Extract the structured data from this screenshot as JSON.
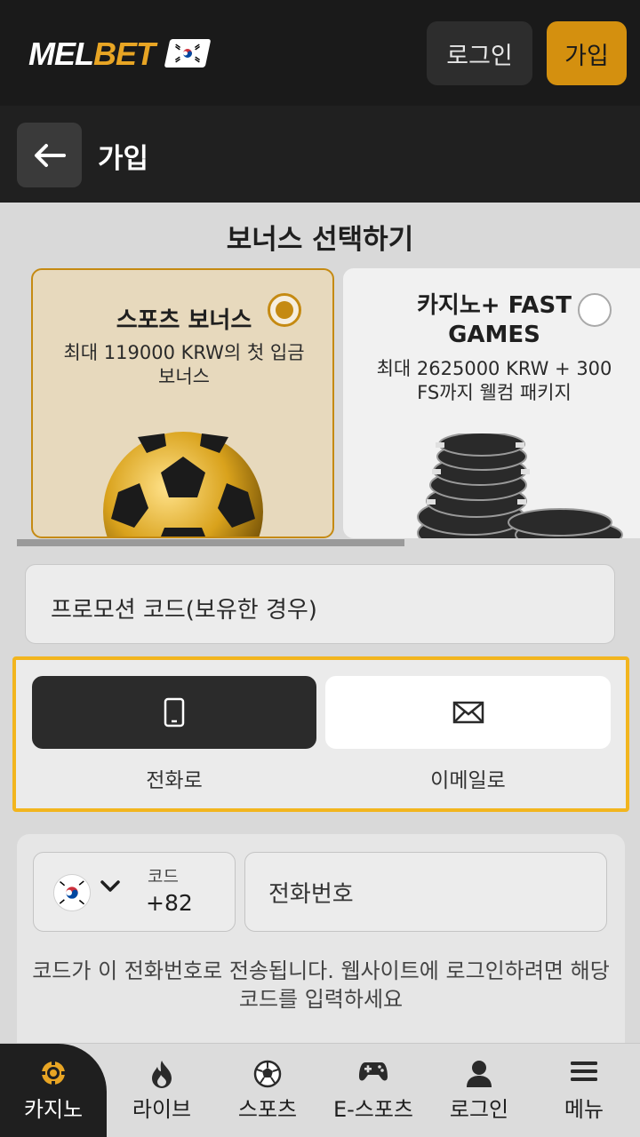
{
  "header": {
    "logo_mel": "MEL",
    "logo_bet": "BET",
    "login_label": "로그인",
    "join_label": "가입"
  },
  "subheader": {
    "title": "가입"
  },
  "bonus": {
    "title": "보너스 선택하기",
    "cards": [
      {
        "title": "스포츠 보너스",
        "desc": "최대 119000 KRW의 첫 입금 보너스",
        "selected": true
      },
      {
        "title": "카지노+ FAST GAMES",
        "desc": "최대 2625000 KRW + 300 FS까지 웰컴 패키지",
        "selected": false
      }
    ]
  },
  "promo": {
    "placeholder": "프로모션 코드(보유한 경우)"
  },
  "method": {
    "phone_label": "전화로",
    "email_label": "이메일로"
  },
  "phone_form": {
    "code_label": "코드",
    "code_value": "+82",
    "phone_placeholder": "전화번호",
    "hint": "코드가 이 전화번호로 전송됩니다. 웹사이트에 로그인하려면 해당 코드를 입력하세요"
  },
  "bottom_nav": [
    {
      "label": "카지노",
      "icon": "casino-chip-icon",
      "active": true
    },
    {
      "label": "라이브",
      "icon": "fire-icon"
    },
    {
      "label": "스포츠",
      "icon": "soccer-ball-icon"
    },
    {
      "label": "E-스포츠",
      "icon": "gamepad-icon"
    },
    {
      "label": "로그인",
      "icon": "user-icon"
    },
    {
      "label": "메뉴",
      "icon": "hamburger-menu-icon"
    }
  ],
  "colors": {
    "accent": "#d4900f",
    "dark": "#1a1a1a",
    "highlight_border": "#f2b51e"
  }
}
